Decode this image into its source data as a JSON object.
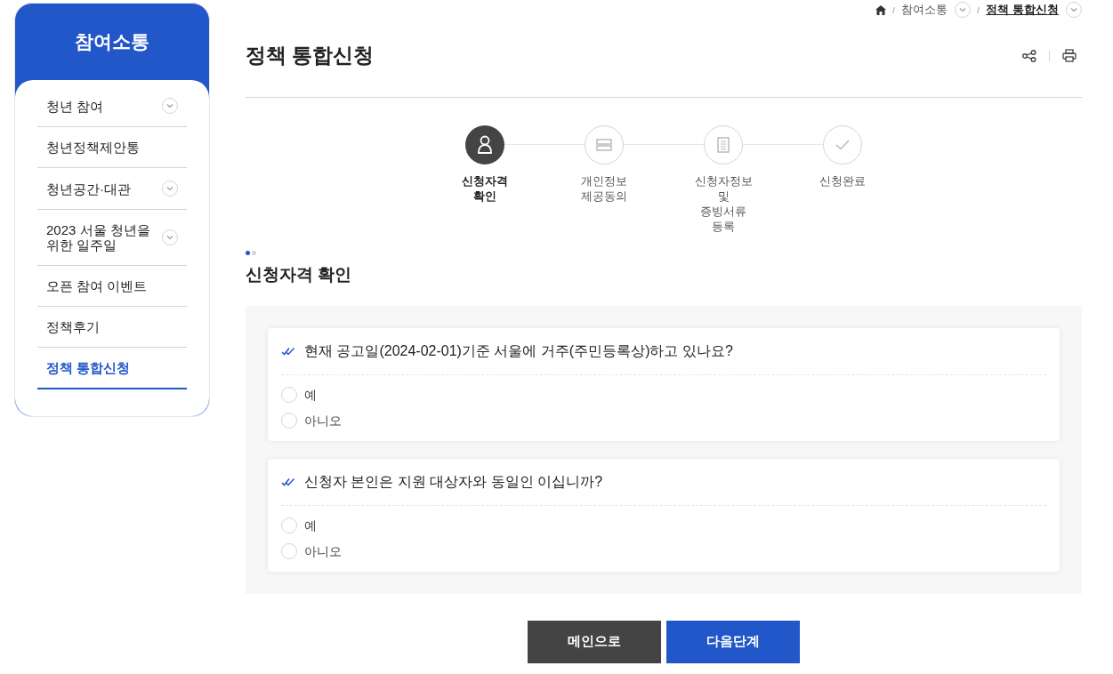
{
  "breadcrumb": [
    {
      "label": "참여소통",
      "current": false
    },
    {
      "label": "정책 통합신청",
      "current": true
    }
  ],
  "sidebar": {
    "title": "참여소통",
    "items": [
      {
        "label": "청년 참여",
        "expandable": true,
        "selected": false
      },
      {
        "label": "청년정책제안통",
        "expandable": false,
        "selected": false
      },
      {
        "label": "청년공간·대관",
        "expandable": true,
        "selected": false
      },
      {
        "label": "2023 서울 청년을\n위한 일주일",
        "expandable": true,
        "selected": false
      },
      {
        "label": "오픈 참여 이벤트",
        "expandable": false,
        "selected": false
      },
      {
        "label": "정책후기",
        "expandable": false,
        "selected": false
      },
      {
        "label": "정책 통합신청",
        "expandable": false,
        "selected": true
      }
    ]
  },
  "page_title": "정책 통합신청",
  "steps": [
    {
      "kind": "person",
      "label": "신청자격\n확인",
      "selected": true
    },
    {
      "kind": "agreement",
      "label": "개인정보\n제공동의",
      "selected": false
    },
    {
      "kind": "document",
      "label": "신청자정보\n및\n증빙서류\n등록",
      "selected": false
    },
    {
      "kind": "check",
      "label": "신청완료",
      "selected": false
    }
  ],
  "section_title": "신청자격 확인",
  "questions": [
    {
      "text": "현재 공고일(2024-02-01)기준 서울에 거주(주민등록상)하고 있나요?",
      "options": [
        {
          "label": "예",
          "selected": false
        },
        {
          "label": "아니오",
          "selected": false
        }
      ]
    },
    {
      "text": "신청자 본인은 지원 대상자와 동일인 이십니까?",
      "options": [
        {
          "label": "예",
          "selected": false
        },
        {
          "label": "아니오",
          "selected": false
        }
      ]
    }
  ],
  "buttons": [
    {
      "kind": "secondary",
      "label": "메인으로"
    },
    {
      "kind": "primary",
      "label": "다음단계"
    }
  ]
}
